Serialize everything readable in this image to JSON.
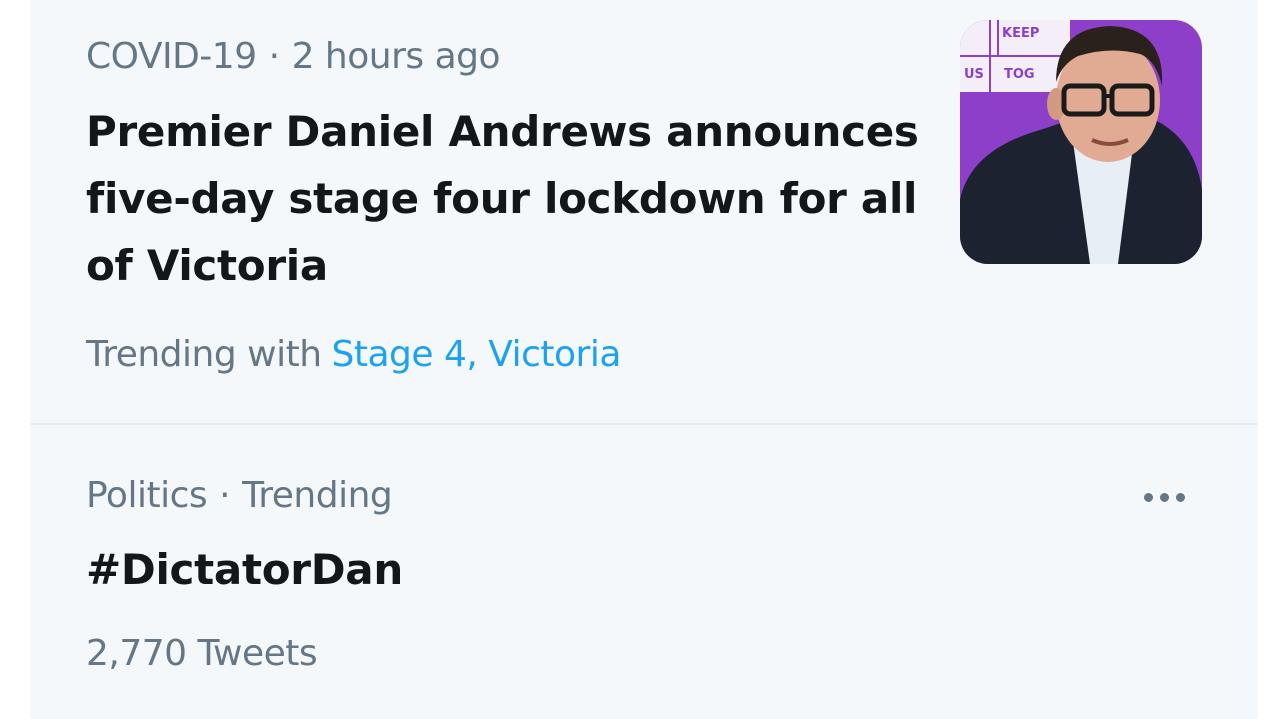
{
  "news_item": {
    "category": "COVID-19",
    "separator": "·",
    "time": "2 hours ago",
    "headline": "Premier Daniel Andrews announces five-day stage four lockdown for all of Victoria",
    "trending_with_label": "Trending with",
    "trending_tags": "Stage 4, Victoria",
    "thumbnail": {
      "background_color": "#8d3fc9",
      "sign_text_1": "KEEP",
      "sign_text_2": "US",
      "sign_text_3": "TOG"
    }
  },
  "trend_item": {
    "category": "Politics",
    "separator": "·",
    "status": "Trending",
    "hashtag": "#DictatorDan",
    "tweet_count": "2,770 Tweets",
    "more_icon": "more-horizontal-icon"
  },
  "colors": {
    "panel_bg": "#f5f8fa",
    "primary_text": "#14171a",
    "secondary_text": "#657786",
    "link": "#1da1f2",
    "divider": "#e6ecf0"
  }
}
